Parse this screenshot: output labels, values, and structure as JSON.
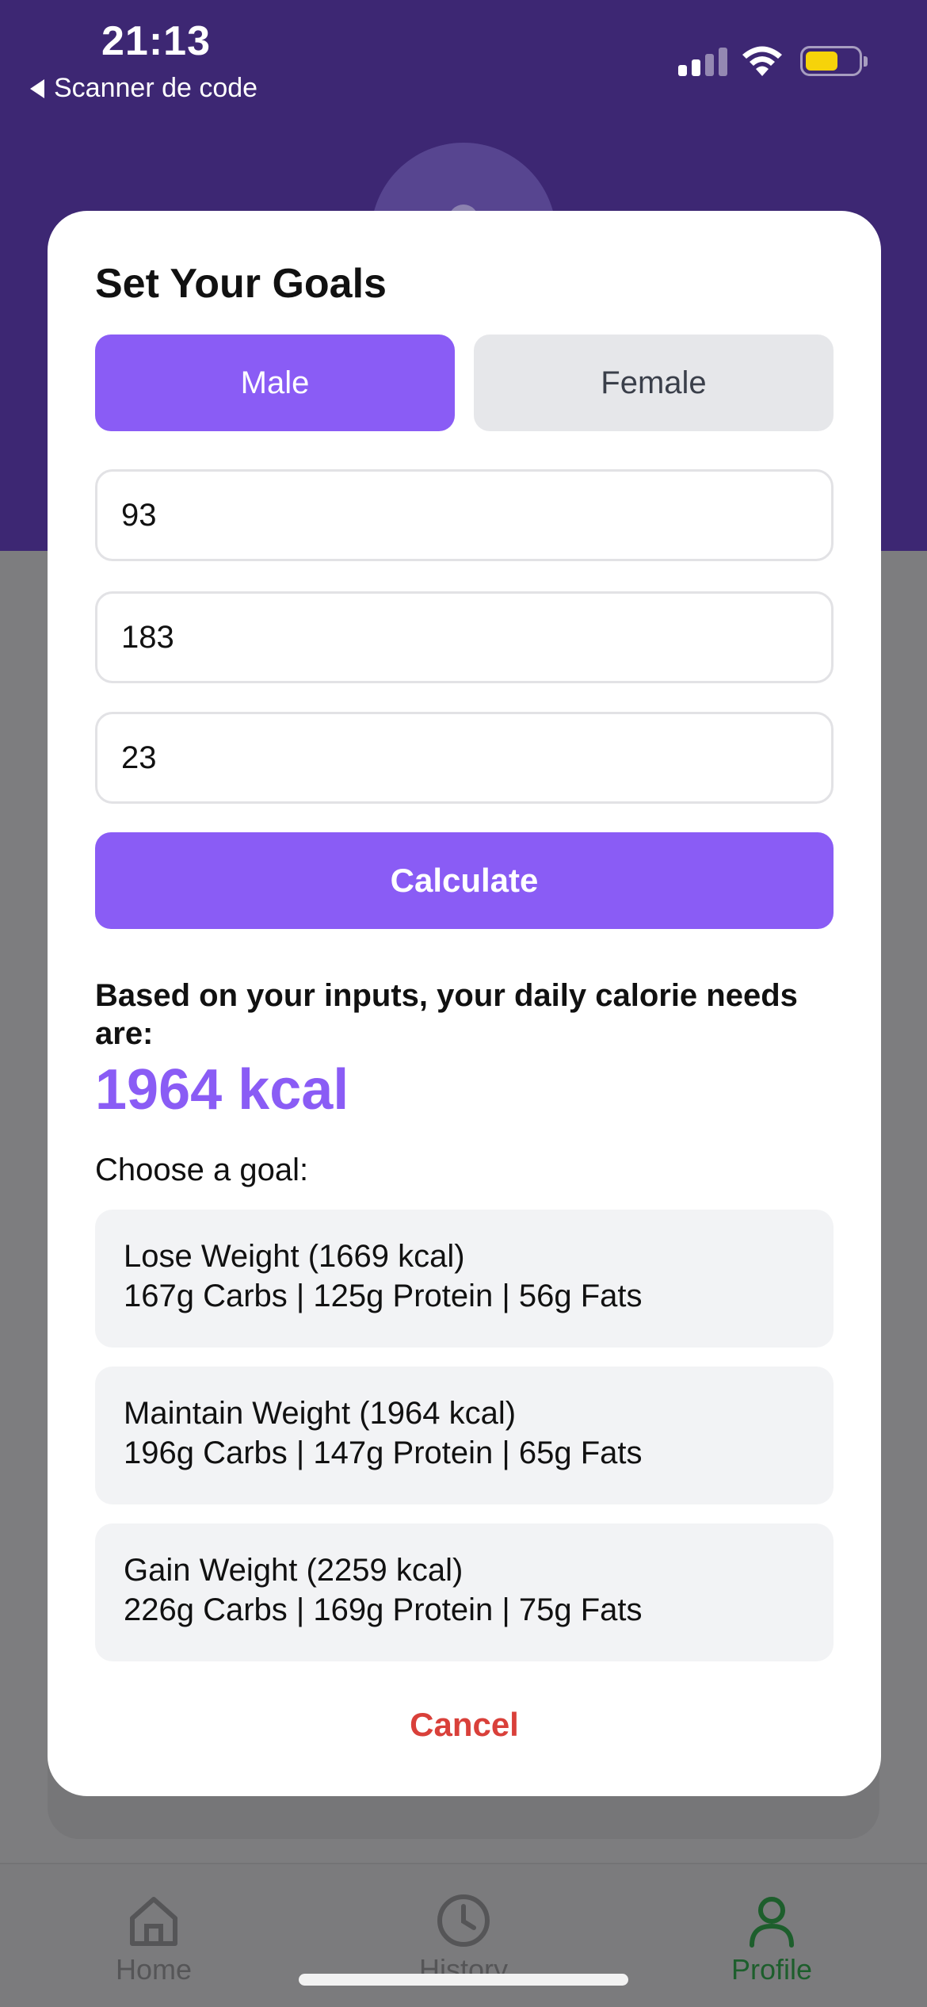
{
  "status_bar": {
    "time": "21:13",
    "back_label": "Scanner de code"
  },
  "modal": {
    "title": "Set Your Goals",
    "gender": {
      "male_label": "Male",
      "female_label": "Female",
      "selected": "Male"
    },
    "fields": {
      "weight": "93",
      "height": "183",
      "age": "23"
    },
    "calculate_label": "Calculate",
    "result_label": "Based on your inputs, your daily calorie needs are:",
    "result_value": "1964 kcal",
    "choose_label": "Choose a goal:",
    "goals": [
      {
        "title": "Lose Weight (1669 kcal)",
        "macros": "167g Carbs | 125g Protein | 56g Fats"
      },
      {
        "title": "Maintain Weight (1964 kcal)",
        "macros": "196g Carbs | 147g Protein | 65g Fats"
      },
      {
        "title": "Gain Weight (2259 kcal)",
        "macros": "226g Carbs | 169g Protein | 75g Fats"
      }
    ],
    "cancel_label": "Cancel"
  },
  "tabbar": {
    "items": [
      {
        "label": "Home",
        "icon": "home-icon"
      },
      {
        "label": "History",
        "icon": "clock-icon"
      },
      {
        "label": "Profile",
        "icon": "person-icon",
        "active": true
      }
    ]
  },
  "colors": {
    "header": "#3d2773",
    "accent": "#8a5cf5",
    "cancel": "#d9403a",
    "active_tab": "#1d5e2c",
    "battery": "#f6d30a"
  }
}
